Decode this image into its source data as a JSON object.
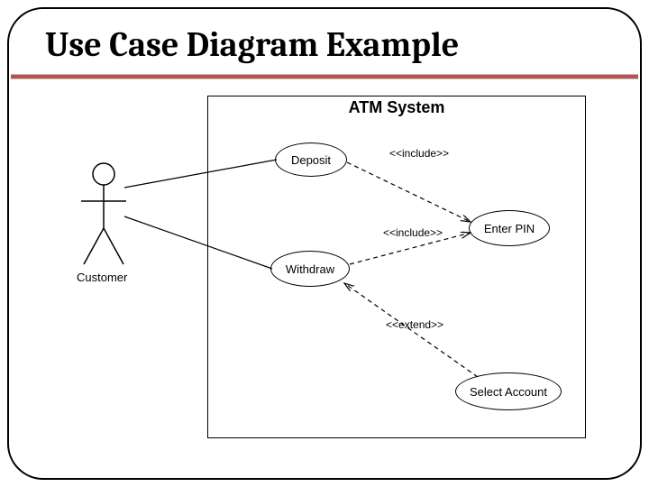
{
  "title": "Use Case Diagram Example",
  "system_name": "ATM System",
  "actor": {
    "name": "Customer"
  },
  "usecases": {
    "deposit": "Deposit",
    "withdraw": "Withdraw",
    "enter_pin": "Enter PIN",
    "select_account": "Select Account"
  },
  "relationships": {
    "include1": "<<include>>",
    "include2": "<<include>>",
    "extend1": "<<extend>>"
  }
}
